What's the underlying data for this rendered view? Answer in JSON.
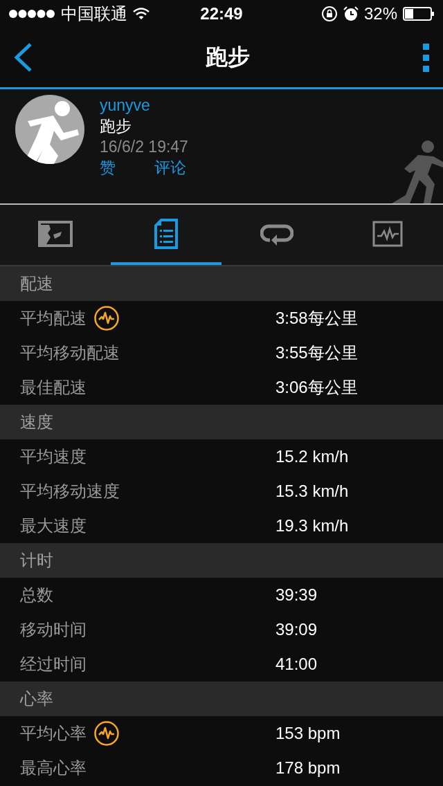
{
  "status_bar": {
    "carrier": "中国联通",
    "time": "22:49",
    "battery": "32%"
  },
  "nav": {
    "title": "跑步"
  },
  "activity": {
    "user": "yunyve",
    "type": "跑步",
    "datetime": "16/6/2 19:47",
    "actions": [
      "赞",
      "评论"
    ]
  },
  "tabs": [
    {
      "kind": "map",
      "selected": false
    },
    {
      "kind": "list",
      "selected": true
    },
    {
      "kind": "loop",
      "selected": false
    },
    {
      "kind": "chart",
      "selected": false
    }
  ],
  "sections": [
    {
      "title": "配速",
      "rows": [
        {
          "label": "平均配速",
          "value": "3:58每公里",
          "hr_icon": true
        },
        {
          "label": "平均移动配速",
          "value": "3:55每公里",
          "hr_icon": false
        },
        {
          "label": "最佳配速",
          "value": "3:06每公里",
          "hr_icon": false
        }
      ]
    },
    {
      "title": "速度",
      "rows": [
        {
          "label": "平均速度",
          "value": "15.2 km/h",
          "hr_icon": false
        },
        {
          "label": "平均移动速度",
          "value": "15.3 km/h",
          "hr_icon": false
        },
        {
          "label": "最大速度",
          "value": "19.3 km/h",
          "hr_icon": false
        }
      ]
    },
    {
      "title": "计时",
      "rows": [
        {
          "label": "总数",
          "value": "39:39",
          "hr_icon": false
        },
        {
          "label": "移动时间",
          "value": "39:09",
          "hr_icon": false
        },
        {
          "label": "经过时间",
          "value": "41:00",
          "hr_icon": false
        }
      ]
    },
    {
      "title": "心率",
      "rows": [
        {
          "label": "平均心率",
          "value": "153 bpm",
          "hr_icon": true
        },
        {
          "label": "最高心率",
          "value": "178 bpm",
          "hr_icon": false
        }
      ]
    }
  ]
}
